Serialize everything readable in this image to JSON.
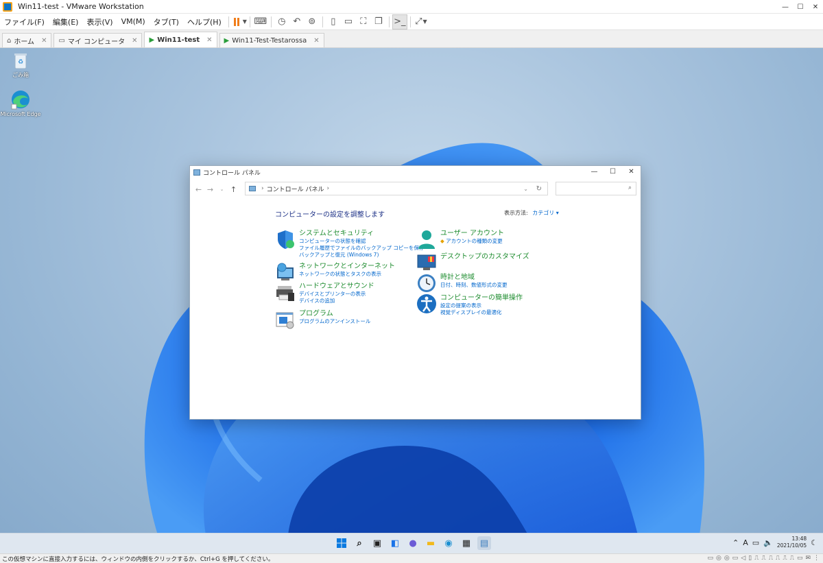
{
  "window": {
    "title": "Win11-test - VMware Workstation"
  },
  "menu": {
    "items": [
      "ファイル(F)",
      "編集(E)",
      "表示(V)",
      "VM(M)",
      "タブ(T)",
      "ヘルプ(H)"
    ]
  },
  "tabs": [
    {
      "label": "ホーム",
      "icon": "home-icon"
    },
    {
      "label": "マイ コンピュータ",
      "icon": "monitor-icon"
    },
    {
      "label": "Win11-test",
      "icon": "vm-icon",
      "active": true
    },
    {
      "label": "Win11-Test-Testarossa",
      "icon": "vm-icon"
    }
  ],
  "desktop": {
    "icons": [
      {
        "label": "ごみ箱",
        "icon": "recycle-bin-icon"
      },
      {
        "label": "Microsoft Edge",
        "icon": "edge-icon"
      }
    ]
  },
  "control_panel": {
    "title": "コントロール パネル",
    "breadcrumb": "コントロール パネル",
    "heading": "コンピューターの設定を調整します",
    "view_by_label": "表示方法:",
    "view_by_value": "カテゴリ",
    "categories_left": [
      {
        "title": "システムとセキュリティ",
        "links": [
          "コンピューターの状態を確認",
          "ファイル履歴でファイルのバックアップ コピーを保存",
          "バックアップと復元 (Windows 7)"
        ]
      },
      {
        "title": "ネットワークとインターネット",
        "links": [
          "ネットワークの状態とタスクの表示"
        ]
      },
      {
        "title": "ハードウェアとサウンド",
        "links": [
          "デバイスとプリンターの表示",
          "デバイスの追加"
        ]
      },
      {
        "title": "プログラム",
        "links": [
          "プログラムのアンインストール"
        ]
      }
    ],
    "categories_right": [
      {
        "title": "ユーザー アカウント",
        "links": [
          "アカウントの種類の変更"
        ]
      },
      {
        "title": "デスクトップのカスタマイズ",
        "links": []
      },
      {
        "title": "時計と地域",
        "links": [
          "日付、時刻、数値形式の変更"
        ]
      },
      {
        "title": "コンピューターの簡単操作",
        "links": [
          "設定の提案の表示",
          "視覚ディスプレイの最適化"
        ]
      }
    ]
  },
  "taskbar": {
    "clock_time": "13:48",
    "clock_date": "2021/10/05",
    "ime": "A"
  },
  "status": {
    "text": "この仮想マシンに直接入力するには、ウィンドウの内側をクリックするか、Ctrl+G を押してください。"
  },
  "colors": {
    "accent_orange": "#f07d1a",
    "cp_heading": "#1e3287",
    "cp_category_green": "#1e8c2f",
    "link_blue": "#0066cc"
  }
}
